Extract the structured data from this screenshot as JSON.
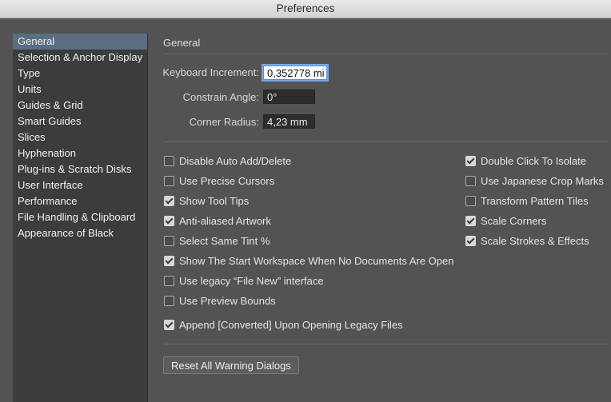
{
  "window": {
    "title": "Preferences"
  },
  "sidebar": {
    "items": [
      {
        "label": "General",
        "selected": true
      },
      {
        "label": "Selection & Anchor Display"
      },
      {
        "label": "Type"
      },
      {
        "label": "Units"
      },
      {
        "label": "Guides & Grid"
      },
      {
        "label": "Smart Guides"
      },
      {
        "label": "Slices"
      },
      {
        "label": "Hyphenation"
      },
      {
        "label": "Plug-ins & Scratch Disks"
      },
      {
        "label": "User Interface"
      },
      {
        "label": "Performance"
      },
      {
        "label": "File Handling & Clipboard"
      },
      {
        "label": "Appearance of Black"
      }
    ]
  },
  "general": {
    "section_title": "General",
    "keyboard_increment": {
      "label": "Keyboard Increment:",
      "value": "0,352778 mi"
    },
    "constrain_angle": {
      "label": "Constrain Angle:",
      "value": "0°"
    },
    "corner_radius": {
      "label": "Corner Radius:",
      "value": "4,23 mm"
    },
    "left_options": [
      {
        "label": "Disable Auto Add/Delete",
        "checked": false
      },
      {
        "label": "Use Precise Cursors",
        "checked": false
      },
      {
        "label": "Show Tool Tips",
        "checked": true
      },
      {
        "label": "Anti-aliased Artwork",
        "checked": true
      },
      {
        "label": "Select Same Tint %",
        "checked": false
      },
      {
        "label": "Show The Start Workspace When No Documents Are Open",
        "checked": true
      },
      {
        "label": "Use legacy “File New” interface",
        "checked": false
      },
      {
        "label": "Use Preview Bounds",
        "checked": false
      },
      {
        "label": "Append [Converted] Upon Opening Legacy Files",
        "checked": true
      }
    ],
    "right_options": [
      {
        "label": "Double Click To Isolate",
        "checked": true
      },
      {
        "label": "Use Japanese Crop Marks",
        "checked": false
      },
      {
        "label": "Transform Pattern Tiles",
        "checked": false
      },
      {
        "label": "Scale Corners",
        "checked": true
      },
      {
        "label": "Scale Strokes & Effects",
        "checked": true
      }
    ],
    "reset_button": "Reset All Warning Dialogs"
  },
  "colors": {
    "background": "#535353",
    "sidebar": "#3c3c3c",
    "selection": "#5a6d83",
    "focus_ring": "#7aa7e4"
  }
}
